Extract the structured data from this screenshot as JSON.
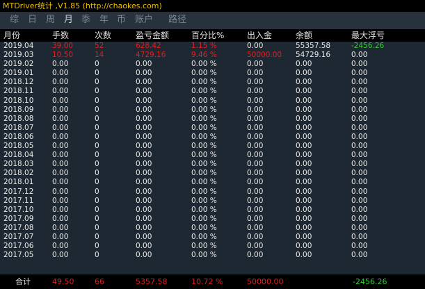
{
  "window": {
    "title": "MTDriver统计 ,V1.85 (http://chaokes.com)"
  },
  "tabs": [
    {
      "label": "综",
      "active": false
    },
    {
      "label": "日",
      "active": false
    },
    {
      "label": "周",
      "active": false
    },
    {
      "label": "月",
      "active": true
    },
    {
      "label": "季",
      "active": false
    },
    {
      "label": "年",
      "active": false
    },
    {
      "label": "币",
      "active": false
    },
    {
      "label": "账户",
      "active": false
    },
    {
      "label": "路径",
      "active": false
    }
  ],
  "columns": [
    "月份",
    "手数",
    "次数",
    "盈亏金额",
    "百分比%",
    "出入金",
    "余额",
    "最大浮亏"
  ],
  "rows": [
    {
      "month": "2019.04",
      "lots": "39.00",
      "count": "52",
      "pl": "628.42",
      "pct": "1.15 %",
      "dep": "0.00",
      "bal": "55357.58",
      "maxdd": "-2456.26",
      "hl": "red-first4",
      "ddc": "green"
    },
    {
      "month": "2019.03",
      "lots": "10.50",
      "count": "14",
      "pl": "4729.16",
      "pct": "9.46 %",
      "dep": "50000.00",
      "bal": "54729.16",
      "maxdd": "0.00",
      "hl": "red-first5",
      "ddc": ""
    },
    {
      "month": "2019.02",
      "lots": "0.00",
      "count": "0",
      "pl": "0.00",
      "pct": "0.00 %",
      "dep": "0.00",
      "bal": "0.00",
      "maxdd": "0.00",
      "hl": "",
      "ddc": ""
    },
    {
      "month": "2019.01",
      "lots": "0.00",
      "count": "0",
      "pl": "0.00",
      "pct": "0.00 %",
      "dep": "0.00",
      "bal": "0.00",
      "maxdd": "0.00",
      "hl": "",
      "ddc": ""
    },
    {
      "month": "2018.12",
      "lots": "0.00",
      "count": "0",
      "pl": "0.00",
      "pct": "0.00 %",
      "dep": "0.00",
      "bal": "0.00",
      "maxdd": "0.00",
      "hl": "",
      "ddc": ""
    },
    {
      "month": "2018.11",
      "lots": "0.00",
      "count": "0",
      "pl": "0.00",
      "pct": "0.00 %",
      "dep": "0.00",
      "bal": "0.00",
      "maxdd": "0.00",
      "hl": "",
      "ddc": ""
    },
    {
      "month": "2018.10",
      "lots": "0.00",
      "count": "0",
      "pl": "0.00",
      "pct": "0.00 %",
      "dep": "0.00",
      "bal": "0.00",
      "maxdd": "0.00",
      "hl": "",
      "ddc": ""
    },
    {
      "month": "2018.09",
      "lots": "0.00",
      "count": "0",
      "pl": "0.00",
      "pct": "0.00 %",
      "dep": "0.00",
      "bal": "0.00",
      "maxdd": "0.00",
      "hl": "",
      "ddc": ""
    },
    {
      "month": "2018.08",
      "lots": "0.00",
      "count": "0",
      "pl": "0.00",
      "pct": "0.00 %",
      "dep": "0.00",
      "bal": "0.00",
      "maxdd": "0.00",
      "hl": "",
      "ddc": ""
    },
    {
      "month": "2018.07",
      "lots": "0.00",
      "count": "0",
      "pl": "0.00",
      "pct": "0.00 %",
      "dep": "0.00",
      "bal": "0.00",
      "maxdd": "0.00",
      "hl": "",
      "ddc": ""
    },
    {
      "month": "2018.06",
      "lots": "0.00",
      "count": "0",
      "pl": "0.00",
      "pct": "0.00 %",
      "dep": "0.00",
      "bal": "0.00",
      "maxdd": "0.00",
      "hl": "",
      "ddc": ""
    },
    {
      "month": "2018.05",
      "lots": "0.00",
      "count": "0",
      "pl": "0.00",
      "pct": "0.00 %",
      "dep": "0.00",
      "bal": "0.00",
      "maxdd": "0.00",
      "hl": "",
      "ddc": ""
    },
    {
      "month": "2018.04",
      "lots": "0.00",
      "count": "0",
      "pl": "0.00",
      "pct": "0.00 %",
      "dep": "0.00",
      "bal": "0.00",
      "maxdd": "0.00",
      "hl": "",
      "ddc": ""
    },
    {
      "month": "2018.03",
      "lots": "0.00",
      "count": "0",
      "pl": "0.00",
      "pct": "0.00 %",
      "dep": "0.00",
      "bal": "0.00",
      "maxdd": "0.00",
      "hl": "",
      "ddc": ""
    },
    {
      "month": "2018.02",
      "lots": "0.00",
      "count": "0",
      "pl": "0.00",
      "pct": "0.00 %",
      "dep": "0.00",
      "bal": "0.00",
      "maxdd": "0.00",
      "hl": "",
      "ddc": ""
    },
    {
      "month": "2018.01",
      "lots": "0.00",
      "count": "0",
      "pl": "0.00",
      "pct": "0.00 %",
      "dep": "0.00",
      "bal": "0.00",
      "maxdd": "0.00",
      "hl": "",
      "ddc": ""
    },
    {
      "month": "2017.12",
      "lots": "0.00",
      "count": "0",
      "pl": "0.00",
      "pct": "0.00 %",
      "dep": "0.00",
      "bal": "0.00",
      "maxdd": "0.00",
      "hl": "",
      "ddc": ""
    },
    {
      "month": "2017.11",
      "lots": "0.00",
      "count": "0",
      "pl": "0.00",
      "pct": "0.00 %",
      "dep": "0.00",
      "bal": "0.00",
      "maxdd": "0.00",
      "hl": "",
      "ddc": ""
    },
    {
      "month": "2017.10",
      "lots": "0.00",
      "count": "0",
      "pl": "0.00",
      "pct": "0.00 %",
      "dep": "0.00",
      "bal": "0.00",
      "maxdd": "0.00",
      "hl": "",
      "ddc": ""
    },
    {
      "month": "2017.09",
      "lots": "0.00",
      "count": "0",
      "pl": "0.00",
      "pct": "0.00 %",
      "dep": "0.00",
      "bal": "0.00",
      "maxdd": "0.00",
      "hl": "",
      "ddc": ""
    },
    {
      "month": "2017.08",
      "lots": "0.00",
      "count": "0",
      "pl": "0.00",
      "pct": "0.00 %",
      "dep": "0.00",
      "bal": "0.00",
      "maxdd": "0.00",
      "hl": "",
      "ddc": ""
    },
    {
      "month": "2017.07",
      "lots": "0.00",
      "count": "0",
      "pl": "0.00",
      "pct": "0.00 %",
      "dep": "0.00",
      "bal": "0.00",
      "maxdd": "0.00",
      "hl": "",
      "ddc": ""
    },
    {
      "month": "2017.06",
      "lots": "0.00",
      "count": "0",
      "pl": "0.00",
      "pct": "0.00 %",
      "dep": "0.00",
      "bal": "0.00",
      "maxdd": "0.00",
      "hl": "",
      "ddc": ""
    },
    {
      "month": "2017.05",
      "lots": "0.00",
      "count": "0",
      "pl": "0.00",
      "pct": "0.00 %",
      "dep": "0.00",
      "bal": "0.00",
      "maxdd": "0.00",
      "hl": "",
      "ddc": ""
    }
  ],
  "total": {
    "label": "合计",
    "lots": "49.50",
    "count": "66",
    "pl": "5357.58",
    "pct": "10.72 %",
    "dep": "50000.00",
    "bal": "",
    "maxdd": "-2456.26"
  },
  "colors": {
    "title": "#f0c000",
    "panel": "#1e2833",
    "tabbar": "#28313c",
    "positive": "#e02020",
    "negative_dd": "#33cc33"
  }
}
